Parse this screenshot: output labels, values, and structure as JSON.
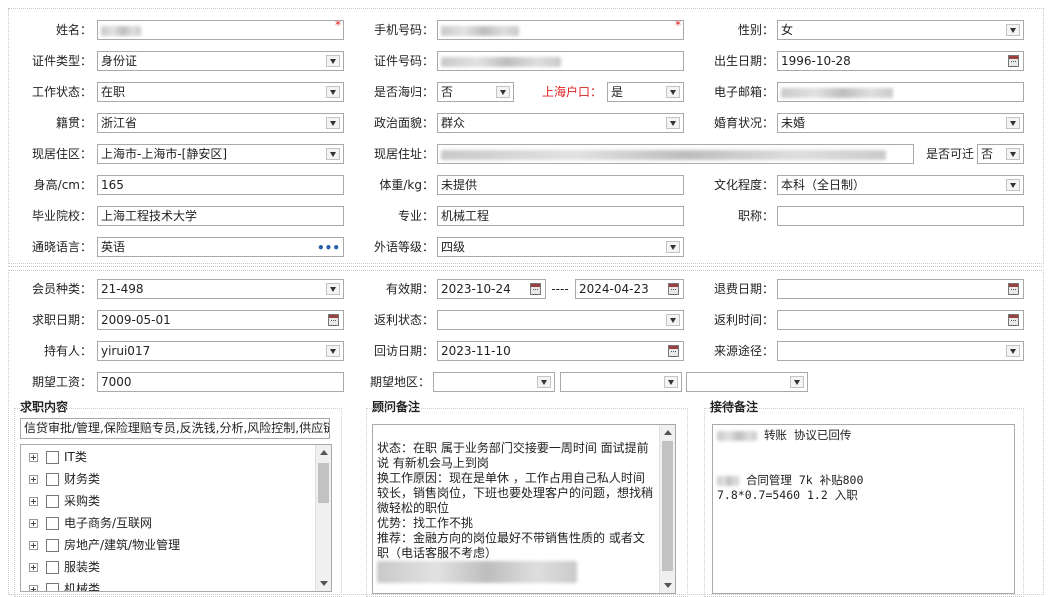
{
  "basic": {
    "name": {
      "label": "姓名：",
      "value": "",
      "required": "*"
    },
    "phone": {
      "label": "手机号码：",
      "value": "",
      "required": "*"
    },
    "gender": {
      "label": "性别：",
      "value": "女"
    },
    "id_type": {
      "label": "证件类型：",
      "value": "身份证"
    },
    "id_number": {
      "label": "证件号码：",
      "value": ""
    },
    "birth_date": {
      "label": "出生日期：",
      "value": "1996-10-28"
    },
    "work_status": {
      "label": "工作状态：",
      "value": "在职"
    },
    "returnee": {
      "label": "是否海归：",
      "value": "否"
    },
    "shanghai_hukou": {
      "label": "上海户口：",
      "value": "是"
    },
    "email": {
      "label": "电子邮箱：",
      "value": ""
    },
    "native_place": {
      "label": "籍贯：",
      "value": "浙江省"
    },
    "political_status": {
      "label": "政治面貌：",
      "value": "群众"
    },
    "marital_status": {
      "label": "婚育状况：",
      "value": "未婚"
    },
    "current_area": {
      "label": "现居住区：",
      "value": "上海市-上海市-[静安区]"
    },
    "current_address": {
      "label": "现居住址：",
      "value": ""
    },
    "relocatable": {
      "label": "是否可迁",
      "value": "否"
    },
    "height": {
      "label": "身高/cm：",
      "value": "165"
    },
    "weight": {
      "label": "体重/kg：",
      "value": "未提供"
    },
    "education": {
      "label": "文化程度：",
      "value": "本科（全日制）"
    },
    "school": {
      "label": "毕业院校：",
      "value": "上海工程技术大学"
    },
    "major": {
      "label": "专业：",
      "value": "机械工程"
    },
    "title": {
      "label": "职称：",
      "value": ""
    },
    "language": {
      "label": "通晓语言：",
      "value": "英语"
    },
    "language_level": {
      "label": "外语等级：",
      "value": "四级"
    }
  },
  "membership": {
    "member_type": {
      "label": "会员种类：",
      "value": "21-498"
    },
    "validity": {
      "label": "有效期：",
      "start": "2023-10-24",
      "separator": "----",
      "end": "2024-04-23"
    },
    "refund_date": {
      "label": "退费日期：",
      "value": ""
    },
    "job_seek_date": {
      "label": "求职日期：",
      "value": "2009-05-01"
    },
    "rebate_status": {
      "label": "返利状态：",
      "value": ""
    },
    "rebate_time": {
      "label": "返利时间：",
      "value": ""
    },
    "holder": {
      "label": "持有人：",
      "value": "yirui017"
    },
    "revisit_date": {
      "label": "回访日期：",
      "value": "2023-11-10"
    },
    "source": {
      "label": "来源途径：",
      "value": ""
    },
    "expected_salary": {
      "label": "期望工资：",
      "value": "7000"
    },
    "expected_area": {
      "label": "期望地区：",
      "values": [
        "",
        "",
        ""
      ]
    }
  },
  "job_content": {
    "title": "求职内容",
    "selected": "信贷审批/管理,保险理赔专员,反洗钱,分析,风险控制,供应链",
    "tree": [
      "IT类",
      "财务类",
      "采购类",
      "电子商务/互联网",
      "房地产/建筑/物业管理",
      "服装类",
      "机械类"
    ]
  },
  "consultant_notes": {
    "title": "顾问备注",
    "lines": [
      "状态：在职 属于业务部门交接要一周时间  面试提前说  有新机会马上到岗",
      "换工作原因：现在是单休 ，工作占用自己私人时间较长，销售岗位，下班也要处理客户的问题，想找稍微轻松的职位",
      "优势：找工作不挑",
      "推荐：金融方向的岗位最好不带销售性质的 或者文职（电话客服不考虑）"
    ]
  },
  "reception_notes": {
    "title": "接待备注",
    "line1": "转账  协议已回传",
    "line2": "合同管理  7k 补贴800",
    "line3": "7.8*0.7=5460 1.2 入职"
  }
}
